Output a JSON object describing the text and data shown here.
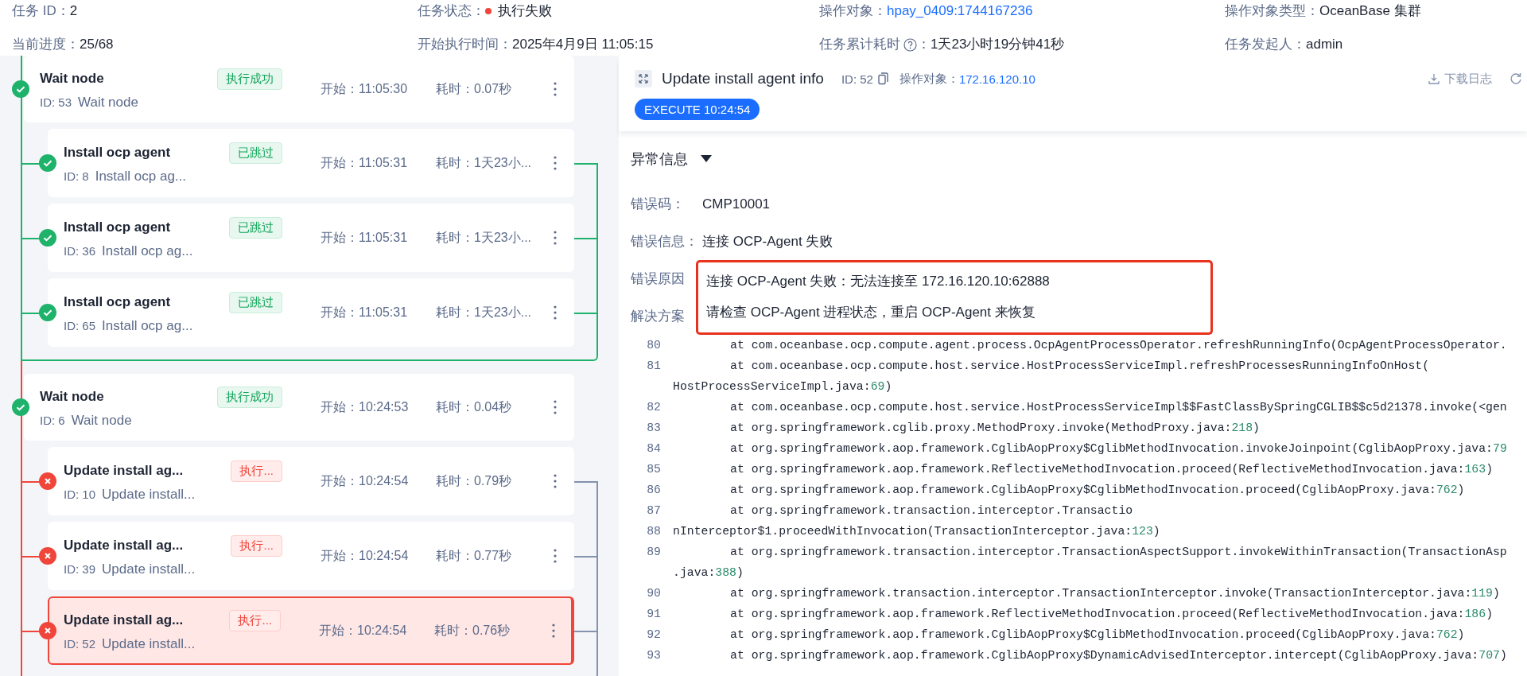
{
  "header": {
    "rows": [
      [
        {
          "label": "任务 ID：",
          "value": "2",
          "kind": "text"
        },
        {
          "label": "任务状态：",
          "value": "执行失败",
          "kind": "status"
        },
        {
          "label": "操作对象：",
          "value": "hpay_0409:1744167236",
          "kind": "link"
        },
        {
          "label": "操作对象类型：",
          "value": "OceanBase 集群",
          "kind": "text"
        }
      ],
      [
        {
          "label": "当前进度：",
          "value": "25/68",
          "kind": "text"
        },
        {
          "label": "开始执行时间：",
          "value": "2025年4月9日 11:05:15",
          "kind": "text"
        },
        {
          "label": "任务累计耗时",
          "suffix": "：",
          "value": "1天23小时19分钟41秒",
          "kind": "help"
        },
        {
          "label": "任务发起人：",
          "value": "admin",
          "kind": "text"
        }
      ]
    ]
  },
  "tree": {
    "groups": [
      {
        "node": {
          "title": "Wait node",
          "kind": "success",
          "tag": "执行成功",
          "id": "ID: 53",
          "name": "Wait node",
          "start": "开始：11:05:30",
          "duration": "耗时：0.07秒",
          "selected": false
        },
        "children": [
          {
            "title": "Install ocp agent",
            "kind": "skipped",
            "tag": "已跳过",
            "id": "ID: 8",
            "name": "Install ocp ag...",
            "start": "开始：11:05:31",
            "duration": "耗时：1天23小...",
            "selected": false
          },
          {
            "title": "Install ocp agent",
            "kind": "skipped",
            "tag": "已跳过",
            "id": "ID: 36",
            "name": "Install ocp ag...",
            "start": "开始：11:05:31",
            "duration": "耗时：1天23小...",
            "selected": false
          },
          {
            "title": "Install ocp agent",
            "kind": "skipped",
            "tag": "已跳过",
            "id": "ID: 65",
            "name": "Install ocp ag...",
            "start": "开始：11:05:31",
            "duration": "耗时：1天23小...",
            "selected": false
          }
        ]
      },
      {
        "node": {
          "title": "Wait node",
          "kind": "success",
          "tag": "执行成功",
          "id": "ID: 6",
          "name": "Wait node",
          "start": "开始：10:24:53",
          "duration": "耗时：0.04秒",
          "selected": false
        },
        "children": [
          {
            "title": "Update install ag...",
            "kind": "failed",
            "tag": "执行...",
            "id": "ID: 10",
            "name": "Update install...",
            "start": "开始：10:24:54",
            "duration": "耗时：0.79秒",
            "selected": false
          },
          {
            "title": "Update install ag...",
            "kind": "failed",
            "tag": "执行...",
            "id": "ID: 39",
            "name": "Update install...",
            "start": "开始：10:24:54",
            "duration": "耗时：0.77秒",
            "selected": false
          },
          {
            "title": "Update install ag...",
            "kind": "failed",
            "tag": "执行...",
            "id": "ID: 52",
            "name": "Update install...",
            "start": "开始：10:24:54",
            "duration": "耗时：0.76秒",
            "selected": true
          }
        ]
      }
    ]
  },
  "detail": {
    "title": "Update install agent info",
    "id": "ID: 52",
    "target_label": "操作对象：",
    "target": "172.16.120.10",
    "badge": "EXECUTE 10:24:54",
    "download": "下载日志",
    "section": "异常信息",
    "section_expanded": true,
    "fields": [
      {
        "label": "错误码：",
        "value": "CMP10001",
        "highlighted": false
      },
      {
        "label": "错误信息：",
        "value": "连接 OCP-Agent 失败",
        "highlighted": false
      },
      {
        "label": "错误原因",
        "value": "连接 OCP-Agent 失败：无法连接至 172.16.120.10:62888",
        "highlighted": true
      },
      {
        "label": "解决方案",
        "value": "请检查 OCP-Agent 进程状态，重启 OCP-Agent 来恢复",
        "highlighted": true
      }
    ],
    "log": [
      {
        "number": "80",
        "indented": true,
        "text": "at com.oceanbase.ocp.compute.agent.process.OcpAgentProcessOperator.refreshRunningInfo(OcpAgentProcessOperator."
      },
      {
        "number": "81",
        "indented": true,
        "text": "at com.oceanbase.ocp.compute.host.service.HostProcessServiceImpl.refreshProcessesRunningInfoOnHost("
      },
      {
        "indented": false,
        "text": "HostProcessServiceImpl.java:",
        "ref": "69",
        "after": ")"
      },
      {
        "number": "82",
        "indented": true,
        "text": "at com.oceanbase.ocp.compute.host.service.HostProcessServiceImpl$$FastClassBySpringCGLIB$$c5d21378.invoke(<gen"
      },
      {
        "number": "83",
        "indented": true,
        "text": "at org.springframework.cglib.proxy.MethodProxy.invoke(MethodProxy.java:",
        "ref": "218",
        "after": ")"
      },
      {
        "number": "84",
        "indented": true,
        "text": "at org.springframework.aop.framework.CglibAopProxy$CglibMethodInvocation.invokeJoinpoint(CglibAopProxy.java:",
        "ref": "79"
      },
      {
        "number": "85",
        "indented": true,
        "text": "at org.springframework.aop.framework.ReflectiveMethodInvocation.proceed(ReflectiveMethodInvocation.java:",
        "ref": "163",
        "after": ")"
      },
      {
        "number": "86",
        "indented": true,
        "text": "at org.springframework.aop.framework.CglibAopProxy$CglibMethodInvocation.proceed(CglibAopProxy.java:",
        "ref": "762",
        "after": ")"
      },
      {
        "number": "87",
        "indented": true,
        "text": "at org.springframework.transaction.interceptor.Transactio"
      },
      {
        "number": "88",
        "indented": false,
        "text": "nInterceptor$1.proceedWithInvocation(TransactionInterceptor.java:",
        "ref": "123",
        "after": ")"
      },
      {
        "number": "89",
        "indented": true,
        "text": "at org.springframework.transaction.interceptor.TransactionAspectSupport.invokeWithinTransaction(TransactionAsp"
      },
      {
        "indented": false,
        "text": ".java:",
        "ref": "388",
        "after": ")"
      },
      {
        "number": "90",
        "indented": true,
        "text": "at org.springframework.transaction.interceptor.TransactionInterceptor.invoke(TransactionInterceptor.java:",
        "ref": "119",
        "after": ")"
      },
      {
        "number": "91",
        "indented": true,
        "text": "at org.springframework.aop.framework.ReflectiveMethodInvocation.proceed(ReflectiveMethodInvocation.java:",
        "ref": "186",
        "after": ")"
      },
      {
        "number": "92",
        "indented": true,
        "text": "at org.springframework.aop.framework.CglibAopProxy$CglibMethodInvocation.proceed(CglibAopProxy.java:",
        "ref": "762",
        "after": ")"
      },
      {
        "number": "93",
        "indented": true,
        "text": "at org.springframework.aop.framework.CglibAopProxy$DynamicAdvisedInterceptor.intercept(CglibAopProxy.java:",
        "ref": "707",
        "after": ")"
      }
    ]
  }
}
